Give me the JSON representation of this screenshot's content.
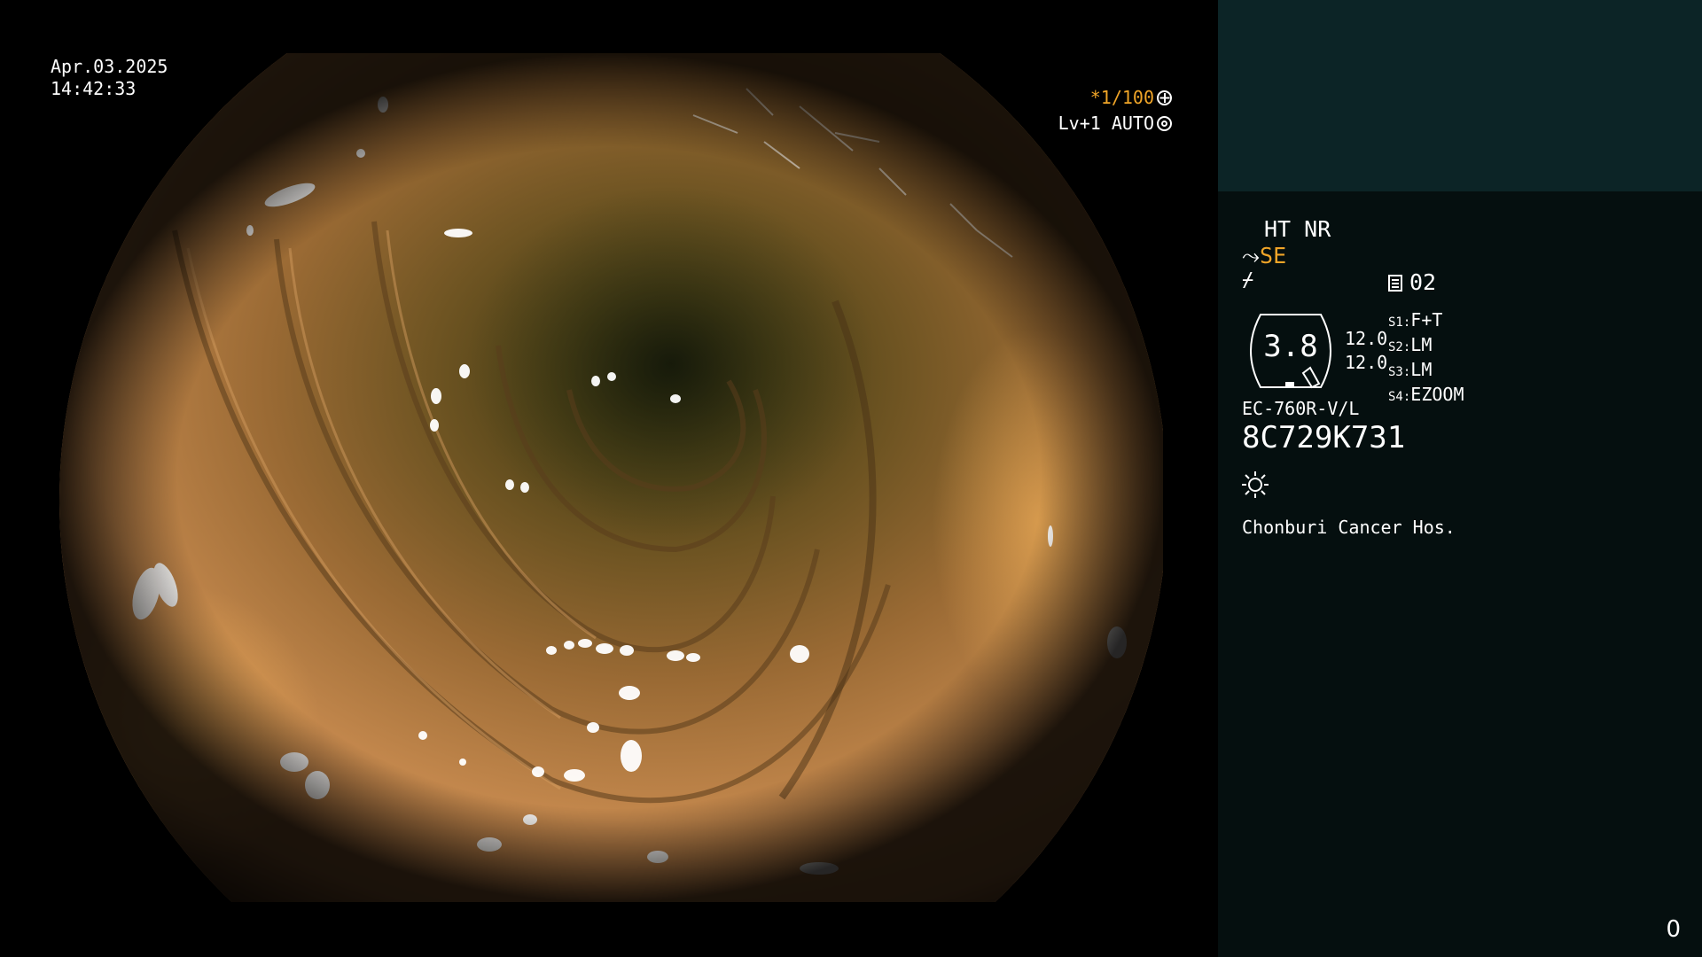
{
  "video": {
    "date": "Apr.03.2025",
    "time": "14:42:33",
    "shutter_prefix": "*",
    "shutter_value": "1/100",
    "level_text": "Lv+1 AUTO",
    "icons": [
      "shutter-icon",
      "auto-iris-icon"
    ]
  },
  "panel": {
    "ht_nr": "HT NR",
    "se_label": "SE",
    "record_number": "02",
    "gauge_value": "3.8",
    "side_values": [
      "12.0",
      "12.0"
    ],
    "scope_switches": [
      {
        "tag": "S1:",
        "value": "F+T"
      },
      {
        "tag": "S2:",
        "value": "LM"
      },
      {
        "tag": "S3:",
        "value": "LM"
      },
      {
        "tag": "S4:",
        "value": "EZOOM"
      }
    ],
    "model": "EC-760R-V/L",
    "serial": "8C729K731",
    "hospital": "Chonburi Cancer Hos.",
    "counter": "0",
    "icons": [
      "scope-mode-icon",
      "filter-icon",
      "record-icon",
      "light-icon"
    ]
  },
  "colors": {
    "accent": "#f0a528",
    "panel_top": "#0c2426",
    "panel_bg": "#050f0f"
  }
}
